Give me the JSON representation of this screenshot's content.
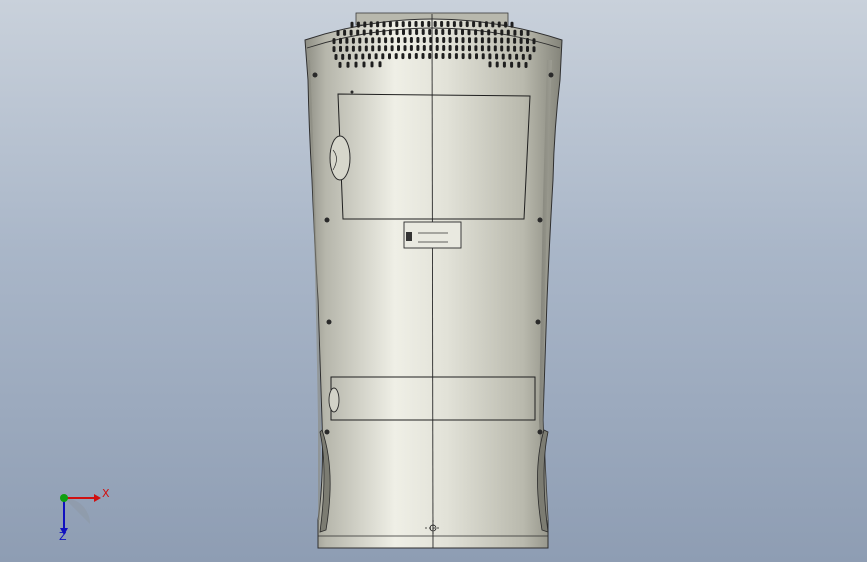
{
  "viewport": {
    "model": "kiosk-enclosure-rear-view",
    "background": "#a9b6c8",
    "body_color": "#c9c9bf"
  },
  "triad": {
    "x_label": "X",
    "z_label": "Z",
    "x_color": "#d01010",
    "y_color": "#10a010",
    "z_color": "#1010c0"
  }
}
